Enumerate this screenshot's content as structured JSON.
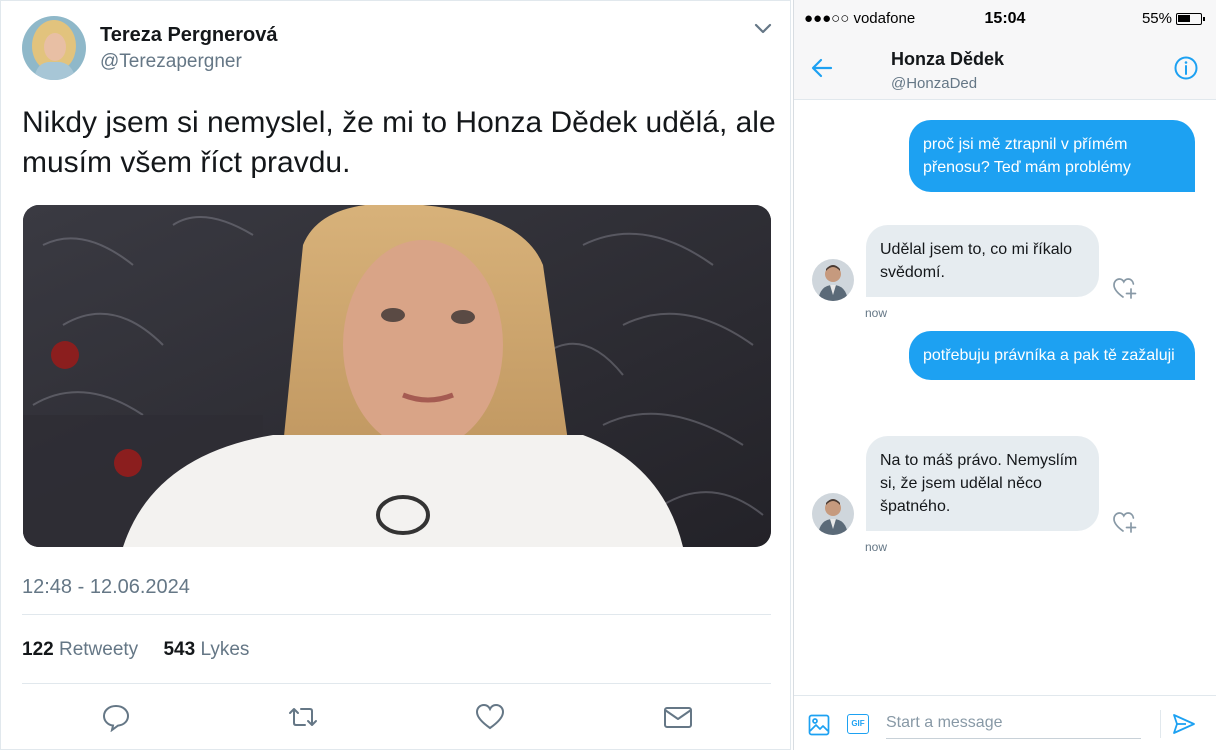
{
  "tweet": {
    "author_name": "Tereza Pergnerová",
    "author_handle": "@Terezapergner",
    "text": "Nikdy jsem si nemyslel, že mi to Honza Dědek udělá, ale musím všem říct pravdu.",
    "timestamp": "12:48 - 12.06.2024",
    "retweets": "122",
    "retweets_label": "Retweety",
    "likes": "543",
    "likes_label": "Lykes",
    "actions": [
      "reply-icon",
      "retweet-icon",
      "like-icon",
      "message-icon"
    ]
  },
  "phone": {
    "statusbar": {
      "carrier": "●●●○○ vodafone",
      "time": "15:04",
      "battery": "55%"
    },
    "dm_header": {
      "name": "Honza Dědek",
      "handle": "@HonzaDed"
    },
    "messages": [
      {
        "direction": "out",
        "text": "proč jsi mě ztrapnil v přímém přenosu? Teď mám problémy"
      },
      {
        "direction": "in",
        "text": "Udělal jsem to, co mi říkalo svědomí.",
        "time": "now"
      },
      {
        "direction": "out",
        "text": "potřebuju právníka a pak tě zažaluji"
      },
      {
        "direction": "in",
        "text": "Na to máš právo. Nemyslím si, že jsem udělal něco špatného.",
        "time": "now"
      }
    ],
    "composer": {
      "placeholder": "Start a message",
      "gif_label": "GIF"
    }
  },
  "colors": {
    "accent": "#1da1f2",
    "secondary_text": "#657786",
    "incoming_bubble": "#e6ecf0"
  }
}
